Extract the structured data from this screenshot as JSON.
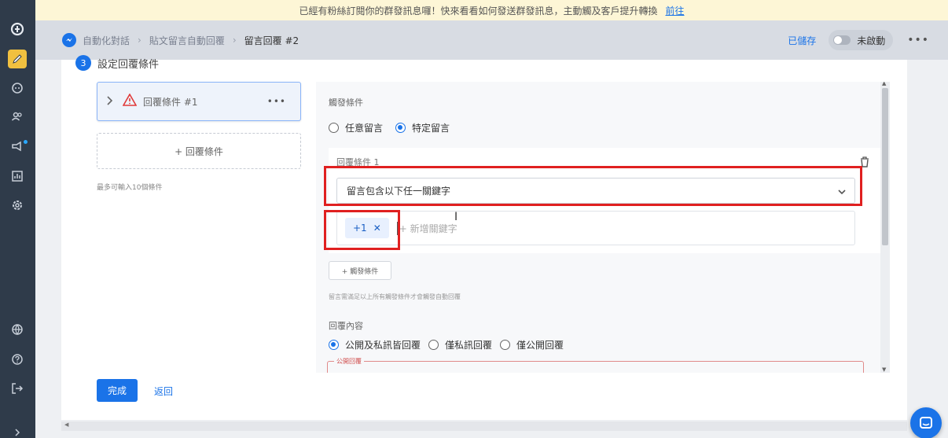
{
  "banner": {
    "text": "已經有粉絲訂閱你的群發訊息囉！快來看看如何發送群發訊息，主動觸及客戶提升轉換",
    "link": "前往"
  },
  "header": {
    "breadcrumb": [
      "自動化對話",
      "貼文留言自動回覆",
      "留言回覆 #2"
    ],
    "saved_label": "已儲存",
    "toggle_label": "未啟動"
  },
  "step": {
    "number": "3",
    "title": "設定回覆條件"
  },
  "left": {
    "condition_item_label": "回覆條件 #1",
    "add_condition": "+ 回覆條件",
    "hint": "最多可輸入10個條件"
  },
  "panel": {
    "trigger_label": "觸發條件",
    "trigger_options": [
      "任意留言",
      "特定留言"
    ],
    "trigger_selected": "特定留言",
    "condition_label": "回覆條件 1",
    "select_value": "留言包含以下任一關鍵字",
    "chip_value": "+1",
    "keyword_placeholder": "+ 新增關鍵字",
    "add_trigger": "+ 觸發條件",
    "hint": "留言需滿足以上所有觸發條件才會觸發自動回覆",
    "reply_label": "回覆內容",
    "reply_options": [
      "公開及私訊皆回覆",
      "僅私訊回覆",
      "僅公開回覆"
    ],
    "reply_selected": "公開及私訊皆回覆",
    "public_reply_label": "公開回覆"
  },
  "footer": {
    "done": "完成",
    "back": "返回"
  },
  "colors": {
    "accent": "#1a73e8",
    "annotation": "#e02020",
    "sidebar": "#2f3b4a"
  }
}
